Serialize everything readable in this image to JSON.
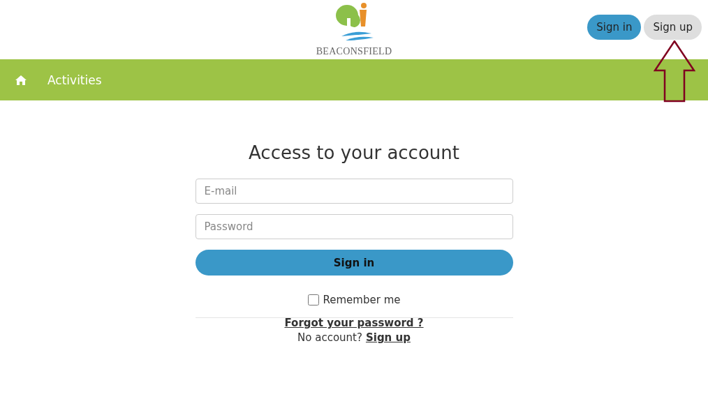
{
  "header": {
    "logo_text": "BEACONSFIELD",
    "buttons": [
      {
        "label": "Sign in",
        "kind": "primary"
      },
      {
        "label": "Sign up",
        "kind": "secondary"
      }
    ]
  },
  "nav": {
    "items": [
      {
        "label": "Activities"
      }
    ]
  },
  "login": {
    "title": "Access to your account",
    "email": {
      "placeholder": "E-mail"
    },
    "password": {
      "placeholder": "Password"
    },
    "submit": "Sign in",
    "remember": {
      "label": "Remember me",
      "checked": false
    },
    "forgot": "Forgot your password ?",
    "no_account": "No account?",
    "signup": "Sign up"
  }
}
